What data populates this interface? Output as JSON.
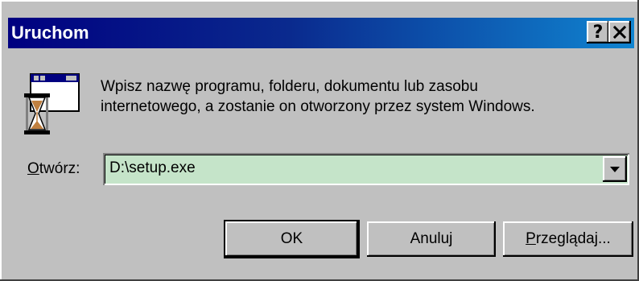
{
  "window": {
    "title": "Uruchom",
    "help_button": "?",
    "close_button": "×"
  },
  "description": {
    "line1": "Wpisz nazwę programu, folderu, dokumentu lub zasobu",
    "line2": "internetowego, a zostanie on otworzony przez system Windows."
  },
  "open": {
    "label_mnemonic": "O",
    "label_rest": "twórz:",
    "value": "D:\\setup.exe"
  },
  "buttons": {
    "ok": "OK",
    "cancel": "Anuluj",
    "browse_mnemonic": "P",
    "browse_rest": "rzeglądaj..."
  },
  "icons": {
    "run": "run-program-hourglass-icon",
    "dropdown": "chevron-down-icon"
  },
  "colors": {
    "titlebar_start": "#000080",
    "titlebar_end": "#1084d0",
    "face": "#c0c0c0",
    "input_bg": "#c5e4c9"
  }
}
